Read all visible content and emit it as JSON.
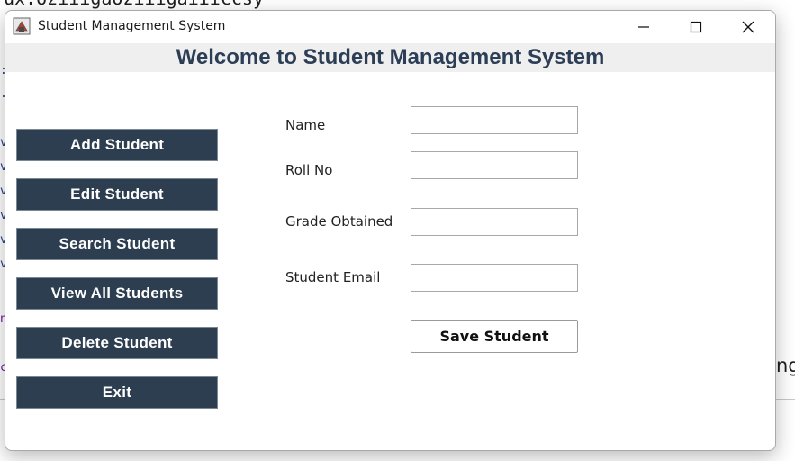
{
  "window": {
    "title": "Student Management System",
    "header": "Welcome to Student Management System"
  },
  "menu": [
    {
      "label": "Add Student"
    },
    {
      "label": "Edit Student"
    },
    {
      "label": "Search Student"
    },
    {
      "label": "View All Students"
    },
    {
      "label": "Delete Student"
    },
    {
      "label": "Exit"
    }
  ],
  "form": {
    "name_label": "Name",
    "name_value": "",
    "roll_label": "Roll No",
    "roll_value": "",
    "grade_label": "Grade Obtained",
    "grade_value": "",
    "email_label": "Student Email",
    "email_value": "",
    "save_label": "Save Student"
  },
  "background": {
    "code_fragment": "ux.oziiigaoziiigaiiiccsy",
    "side_fragment": "ng"
  },
  "colors": {
    "button_bg": "#2c3e50",
    "header_text": "#2c3e55",
    "header_band": "#efefef"
  },
  "icons": {
    "app": "java-app-icon",
    "minimize": "minimize-icon",
    "maximize": "maximize-icon",
    "close": "close-icon"
  }
}
